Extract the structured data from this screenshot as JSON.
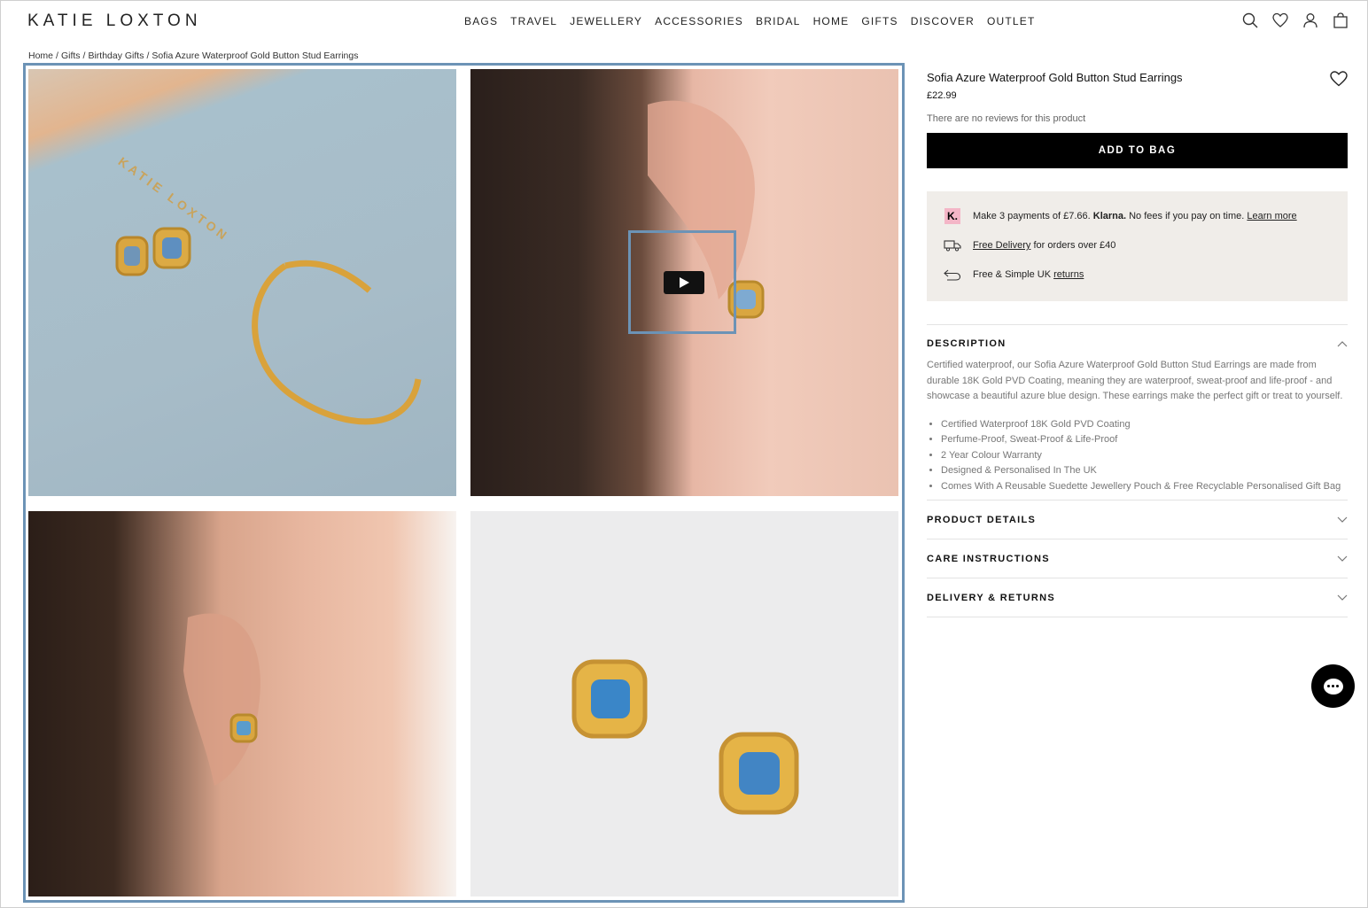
{
  "brand": {
    "logo": "KATIE LOXTON"
  },
  "nav": {
    "items": [
      "BAGS",
      "TRAVEL",
      "JEWELLERY",
      "ACCESSORIES",
      "BRIDAL",
      "HOME",
      "GIFTS",
      "DISCOVER",
      "OUTLET"
    ]
  },
  "header_icons": [
    "search-icon",
    "heart-icon",
    "account-icon",
    "bag-icon"
  ],
  "breadcrumb": {
    "items": [
      "Home",
      "Gifts",
      "Birthday Gifts",
      "Sofia Azure Waterproof Gold Button Stud Earrings"
    ],
    "separator": "/"
  },
  "gallery": {
    "pouch_text": "KATIE LOXTON",
    "images": [
      {
        "alt": "earrings and bangle on pouch"
      },
      {
        "alt": "model wearing earring - video"
      },
      {
        "alt": "model wearing earring"
      },
      {
        "alt": "pair of earrings"
      }
    ]
  },
  "product": {
    "title": "Sofia Azure Waterproof Gold Button Stud Earrings",
    "price": "£22.99",
    "reviews": "There are no reviews for this product",
    "add_to_bag": "ADD TO BAG"
  },
  "info": {
    "klarna_badge": "K.",
    "klarna_pre": "Make 3 payments of £7.66.",
    "klarna_brand": "Klarna.",
    "klarna_post": "No fees if you pay on time.",
    "klarna_link": "Learn more",
    "delivery_link": "Free Delivery",
    "delivery_text": "for orders over £40",
    "returns_text": "Free & Simple UK",
    "returns_link": "returns"
  },
  "description": {
    "heading": "DESCRIPTION",
    "text": "Certified waterproof, our Sofia Azure Waterproof Gold Button Stud Earrings are made from durable 18K Gold PVD Coating, meaning they are waterproof, sweat-proof and life-proof - and showcase a beautiful azure blue design. These earrings make the perfect gift or treat to yourself.",
    "bullets": [
      "Certified Waterproof 18K Gold PVD Coating",
      "Perfume-Proof, Sweat-Proof & Life-Proof",
      "2 Year Colour Warranty",
      "Designed & Personalised In The UK",
      "Comes With A Reusable Suedette Jewellery Pouch & Free Recyclable Personalised Gift Bag"
    ]
  },
  "accordions": [
    "PRODUCT DETAILS",
    "CARE INSTRUCTIONS",
    "DELIVERY & RETURNS"
  ],
  "colors": {
    "accent_frame": "#6c93b6",
    "button": "#000000",
    "info_bg": "#f0ede9",
    "klarna_pink": "#f4b6c7"
  }
}
